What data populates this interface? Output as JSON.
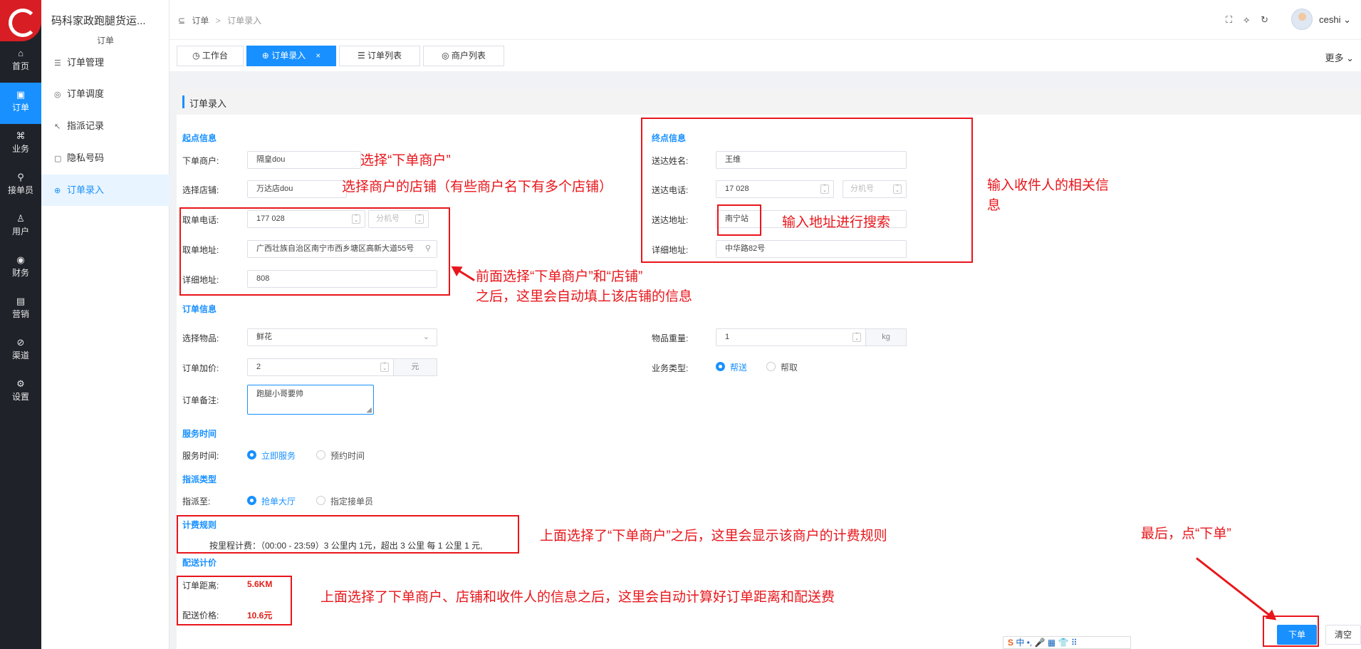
{
  "rail": {
    "items": [
      {
        "label": "首页",
        "icon": "⌂"
      },
      {
        "label": "订单",
        "icon": "▣"
      },
      {
        "label": "业务",
        "icon": "⌘"
      },
      {
        "label": "接单员",
        "icon": "⚲"
      },
      {
        "label": "用户",
        "icon": "♙"
      },
      {
        "label": "财务",
        "icon": "◉"
      },
      {
        "label": "营销",
        "icon": "▤"
      },
      {
        "label": "渠道",
        "icon": "⊘"
      },
      {
        "label": "设置",
        "icon": "⚙"
      }
    ]
  },
  "submenu": {
    "app_title": "码科家政跑腿货运...",
    "section": "订单",
    "items": [
      {
        "label": "订单管理",
        "icon": "☰"
      },
      {
        "label": "订单调度",
        "icon": "◎"
      },
      {
        "label": "指派记录",
        "icon": "↖"
      },
      {
        "label": "隐私号码",
        "icon": "▢"
      },
      {
        "label": "订单录入",
        "icon": "⊕"
      }
    ]
  },
  "header": {
    "crumb_icon": "⊆",
    "crumb_1": "订单",
    "crumb_sep": ">",
    "crumb_2": "订单录入",
    "user": "ceshi",
    "tools": [
      "⛶",
      "⟡",
      "↻"
    ]
  },
  "tabs": {
    "items": [
      {
        "label": "工作台",
        "icon": "◷"
      },
      {
        "label": "订单录入",
        "icon": "⊕",
        "close": "×"
      },
      {
        "label": "订单列表",
        "icon": "☰"
      },
      {
        "label": "商户列表",
        "icon": "◎"
      }
    ],
    "more": "更多"
  },
  "card": {
    "title": "订单录入"
  },
  "origin": {
    "section": "起点信息",
    "merchant_label": "下单商户:",
    "merchant_value": "隔皇dou",
    "shop_label": "选择店铺:",
    "shop_value": "万达店dou",
    "phone_label": "取单电话:",
    "phone_value": "177   028",
    "ext_placeholder": "分机号",
    "address_label": "取单地址:",
    "address_value": "广西壮族自治区南宁市西乡塘区高新大道55号",
    "detail_label": "详细地址:",
    "detail_value": "808"
  },
  "dest": {
    "section": "终点信息",
    "name_label": "送达姓名:",
    "name_value": "王维",
    "phone_label": "送达电话:",
    "phone_value": "17   028",
    "ext_placeholder": "分机号",
    "address_label": "送达地址:",
    "address_value": "南宁站",
    "detail_label": "详细地址:",
    "detail_value": "中华路82号"
  },
  "order": {
    "section": "订单信息",
    "goods_label": "选择物品:",
    "goods_value": "鲜花",
    "weight_label": "物品重量:",
    "weight_value": "1",
    "weight_unit": "kg",
    "markup_label": "订单加价:",
    "markup_value": "2",
    "markup_unit": "元",
    "type_label": "业务类型:",
    "type_opt1": "帮送",
    "type_opt2": "帮取",
    "remark_label": "订单备注:",
    "remark_value": "跑腿小哥要帅"
  },
  "service": {
    "section": "服务时间",
    "label": "服务时间:",
    "opt1": "立即服务",
    "opt2": "预约时间"
  },
  "assign": {
    "section": "指派类型",
    "label": "指派至:",
    "opt1": "抢单大厅",
    "opt2": "指定接单员"
  },
  "billing": {
    "section": "计费规则",
    "rule": "按里程计费：（00:00 - 23:59）3 公里内 1元，超出 3 公里 每 1 公里 1 元,"
  },
  "pricing": {
    "section": "配送计价",
    "distance_label": "订单距离:",
    "distance_value": "5.6KM",
    "price_label": "配送价格:",
    "price_value": "10.6元"
  },
  "buttons": {
    "submit": "下单",
    "clear": "清空"
  },
  "annotations": {
    "a1": "选择“下单商户”",
    "a2": "选择商户的店铺（有些商户名下有多个店铺）",
    "a3_line1": "前面选择“下单商户”和“店铺”",
    "a3_line2": "之后，这里会自动填上该店铺的信息",
    "a4_line1": "输入收件人的相关信",
    "a4_line2": "息",
    "a5": "输入地址进行搜索",
    "a6": "上面选择了“下单商户”之后，这里会显示该商户的计费规则",
    "a7": "上面选择了下单商户、店铺和收件人的信息之后，这里会自动计算好订单距离和配送费",
    "a8": "最后，点“下单”"
  },
  "ime": {
    "items": [
      "S",
      "中",
      "•,",
      "🎤",
      "▦",
      "👕",
      "⠿"
    ]
  },
  "colors": {
    "accent": "#1890ff",
    "annotation": "#e8161b",
    "rail": "#1f2229"
  }
}
